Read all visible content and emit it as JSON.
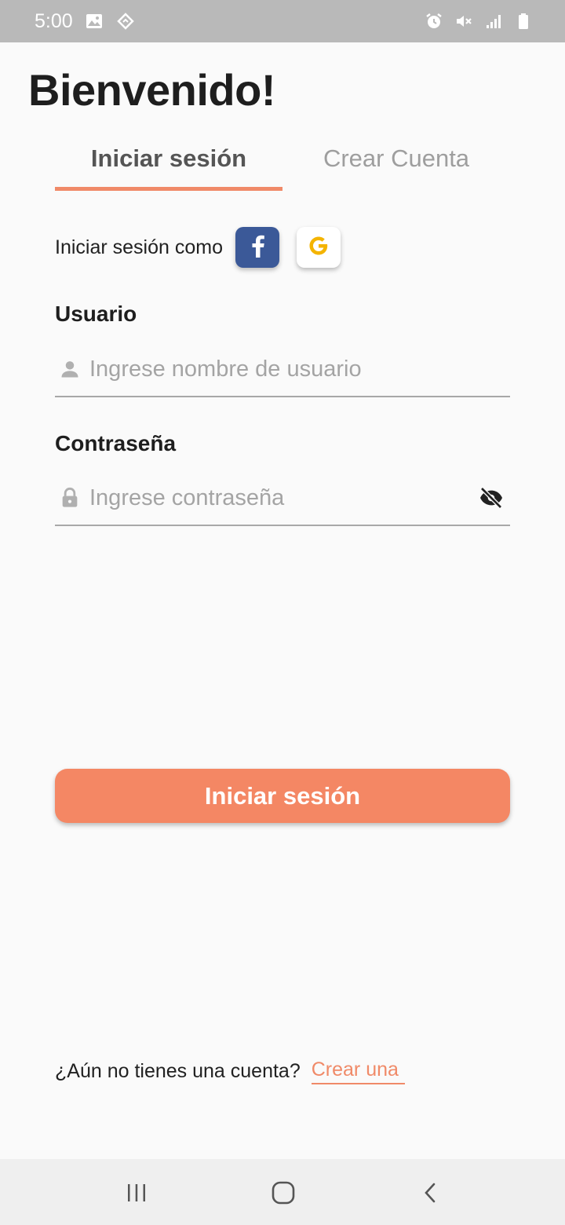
{
  "status_bar": {
    "time": "5:00",
    "left_icons": [
      "image-icon",
      "navigation-diamond-icon"
    ],
    "right_icons": [
      "alarm-icon",
      "vibrate-mute-icon",
      "signal-icon",
      "battery-icon"
    ]
  },
  "page": {
    "title": "Bienvenido!"
  },
  "tabs": {
    "login_label": "Iniciar sesión",
    "create_label": "Crear Cuenta",
    "active": "login"
  },
  "social": {
    "label": "Iniciar sesión como",
    "facebook_icon": "facebook-icon",
    "google_icon": "google-icon"
  },
  "form": {
    "username_label": "Usuario",
    "username_placeholder": "Ingrese nombre de usuario",
    "username_value": "",
    "password_label": "Contraseña",
    "password_placeholder": "Ingrese contraseña",
    "password_value": ""
  },
  "actions": {
    "submit_label": "Iniciar sesión"
  },
  "signup": {
    "prompt": "¿Aún no tienes una cuenta?",
    "link": "Crear una"
  },
  "colors": {
    "accent": "#f48764",
    "facebook": "#3b5998",
    "google_g": "#f4b400",
    "status_bar": "#b9b9b9"
  },
  "nav_bar": {
    "icons": [
      "recents-icon",
      "home-icon",
      "back-icon"
    ]
  }
}
